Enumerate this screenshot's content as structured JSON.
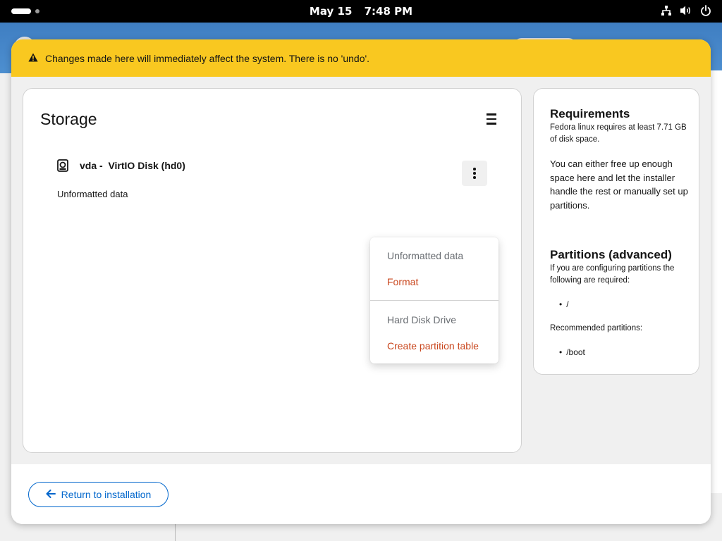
{
  "topbar": {
    "date": "May 15",
    "time": "7:48 PM",
    "icons": [
      "network-icon",
      "volume-icon",
      "power-icon"
    ]
  },
  "warning": {
    "icon": "warning-icon",
    "text": "Changes made here will immediately affect the system. There is no 'undo'."
  },
  "storage": {
    "title": "Storage",
    "menu_icon": "hamburger-icon",
    "disk": {
      "icon": "hard-disk-icon",
      "name": "vda -  VirtIO Disk (hd0)",
      "content": "Unformatted data",
      "actions_icon": "kebab-icon"
    },
    "menu": {
      "group1_title": "Unformatted data",
      "group1_action": "Format",
      "group2_title": "Hard Disk Drive",
      "group2_action": "Create partition table"
    }
  },
  "requirements": {
    "title": "Requirements",
    "summary": "Fedora linux requires at least 7.71 GB of disk space.",
    "body": "You can either free up enough space here and let the installer handle the rest or manually set up partitions.",
    "partitions_title": "Partitions (advanced)",
    "partitions_text": "If you are configuring partitions the following are required:",
    "required": [
      "/"
    ],
    "recommended_label": "Recommended partitions:",
    "recommended": [
      "/boot"
    ]
  },
  "footer": {
    "return_label": "Return to installation",
    "return_icon": "arrow-left-icon"
  },
  "colors": {
    "warning": "#f9c820",
    "danger_action": "#c9471e",
    "link": "#0066cc"
  }
}
